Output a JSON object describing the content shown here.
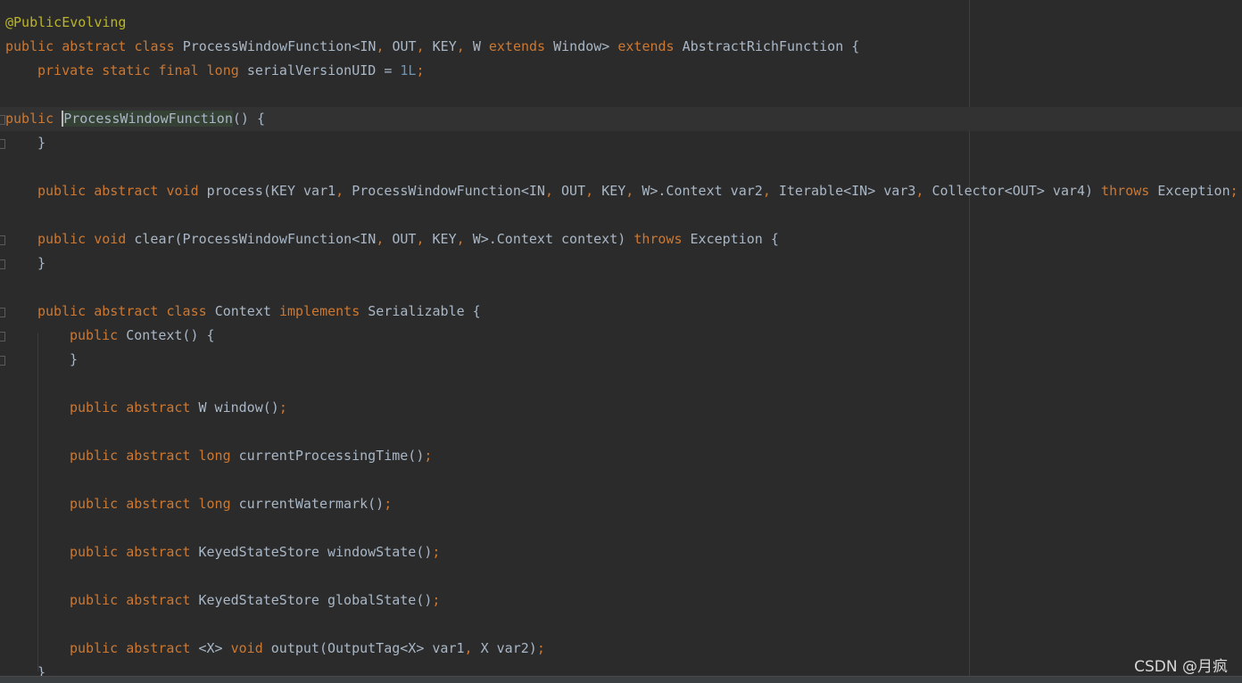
{
  "editor": {
    "colors": {
      "background": "#2b2b2b",
      "keyword": "#cc7832",
      "annotation": "#bbb529",
      "number": "#6897bb",
      "text": "#a9b7c6",
      "highlight": "#344134"
    },
    "lines": [
      {
        "indent": 0,
        "tokens": [
          [
            "ann",
            "@PublicEvolving"
          ]
        ]
      },
      {
        "indent": 0,
        "tokens": [
          [
            "kw",
            "public abstract class "
          ],
          [
            "tx",
            "ProcessWindowFunction<IN"
          ],
          [
            "pn",
            ", "
          ],
          [
            "tx",
            "OUT"
          ],
          [
            "pn",
            ", "
          ],
          [
            "tx",
            "KEY"
          ],
          [
            "pn",
            ", "
          ],
          [
            "tx",
            "W "
          ],
          [
            "kw",
            "extends "
          ],
          [
            "tx",
            "Window> "
          ],
          [
            "kw",
            "extends "
          ],
          [
            "tx",
            "AbstractRichFunction {"
          ]
        ]
      },
      {
        "indent": 1,
        "tokens": [
          [
            "kw",
            "private static final long "
          ],
          [
            "tx",
            "serialVersionUID = "
          ],
          [
            "num",
            "1L"
          ],
          [
            "pn",
            ";"
          ]
        ]
      },
      {
        "indent": 1,
        "tokens": []
      },
      {
        "indent": 1,
        "caret": true,
        "tokens": [
          [
            "kw",
            "public "
          ],
          [
            "hl",
            "ProcessWindowFunction"
          ],
          [
            "tx",
            "() {"
          ]
        ]
      },
      {
        "indent": 1,
        "tokens": [
          [
            "tx",
            "}"
          ]
        ]
      },
      {
        "indent": 1,
        "tokens": []
      },
      {
        "indent": 1,
        "tokens": [
          [
            "kw",
            "public abstract void "
          ],
          [
            "tx",
            "process(KEY var1"
          ],
          [
            "pn",
            ", "
          ],
          [
            "tx",
            "ProcessWindowFunction<IN"
          ],
          [
            "pn",
            ", "
          ],
          [
            "tx",
            "OUT"
          ],
          [
            "pn",
            ", "
          ],
          [
            "tx",
            "KEY"
          ],
          [
            "pn",
            ", "
          ],
          [
            "tx",
            "W>.Context var2"
          ],
          [
            "pn",
            ", "
          ],
          [
            "tx",
            "Iterable<IN> var3"
          ],
          [
            "pn",
            ", "
          ],
          [
            "tx",
            "Collector<OUT> var4) "
          ],
          [
            "kw",
            "throws "
          ],
          [
            "tx",
            "Exception"
          ],
          [
            "pn",
            ";"
          ]
        ]
      },
      {
        "indent": 1,
        "tokens": []
      },
      {
        "indent": 1,
        "tokens": [
          [
            "kw",
            "public void "
          ],
          [
            "tx",
            "clear(ProcessWindowFunction<IN"
          ],
          [
            "pn",
            ", "
          ],
          [
            "tx",
            "OUT"
          ],
          [
            "pn",
            ", "
          ],
          [
            "tx",
            "KEY"
          ],
          [
            "pn",
            ", "
          ],
          [
            "tx",
            "W>.Context context) "
          ],
          [
            "kw",
            "throws "
          ],
          [
            "tx",
            "Exception {"
          ]
        ]
      },
      {
        "indent": 1,
        "tokens": [
          [
            "tx",
            "}"
          ]
        ]
      },
      {
        "indent": 1,
        "tokens": []
      },
      {
        "indent": 1,
        "tokens": [
          [
            "kw",
            "public abstract class "
          ],
          [
            "tx",
            "Context "
          ],
          [
            "kw",
            "implements "
          ],
          [
            "tx",
            "Serializable {"
          ]
        ]
      },
      {
        "indent": 2,
        "tokens": [
          [
            "kw",
            "public "
          ],
          [
            "tx",
            "Context() {"
          ]
        ]
      },
      {
        "indent": 2,
        "tokens": [
          [
            "tx",
            "}"
          ]
        ]
      },
      {
        "indent": 2,
        "tokens": []
      },
      {
        "indent": 2,
        "tokens": [
          [
            "kw",
            "public abstract "
          ],
          [
            "tx",
            "W window()"
          ],
          [
            "pn",
            ";"
          ]
        ]
      },
      {
        "indent": 2,
        "tokens": []
      },
      {
        "indent": 2,
        "tokens": [
          [
            "kw",
            "public abstract long "
          ],
          [
            "tx",
            "currentProcessingTime()"
          ],
          [
            "pn",
            ";"
          ]
        ]
      },
      {
        "indent": 2,
        "tokens": []
      },
      {
        "indent": 2,
        "tokens": [
          [
            "kw",
            "public abstract long "
          ],
          [
            "tx",
            "currentWatermark()"
          ],
          [
            "pn",
            ";"
          ]
        ]
      },
      {
        "indent": 2,
        "tokens": []
      },
      {
        "indent": 2,
        "tokens": [
          [
            "kw",
            "public abstract "
          ],
          [
            "tx",
            "KeyedStateStore windowState()"
          ],
          [
            "pn",
            ";"
          ]
        ]
      },
      {
        "indent": 2,
        "tokens": []
      },
      {
        "indent": 2,
        "tokens": [
          [
            "kw",
            "public abstract "
          ],
          [
            "tx",
            "KeyedStateStore globalState()"
          ],
          [
            "pn",
            ";"
          ]
        ]
      },
      {
        "indent": 2,
        "tokens": []
      },
      {
        "indent": 2,
        "tokens": [
          [
            "kw",
            "public abstract "
          ],
          [
            "tx",
            "<X> "
          ],
          [
            "kw",
            "void "
          ],
          [
            "tx",
            "output(OutputTag<X> var1"
          ],
          [
            "pn",
            ", "
          ],
          [
            "tx",
            "X var2)"
          ],
          [
            "pn",
            ";"
          ]
        ]
      },
      {
        "indent": 1,
        "tokens": [
          [
            "tx",
            "}"
          ]
        ]
      }
    ]
  },
  "watermark": "CSDN @月疯"
}
